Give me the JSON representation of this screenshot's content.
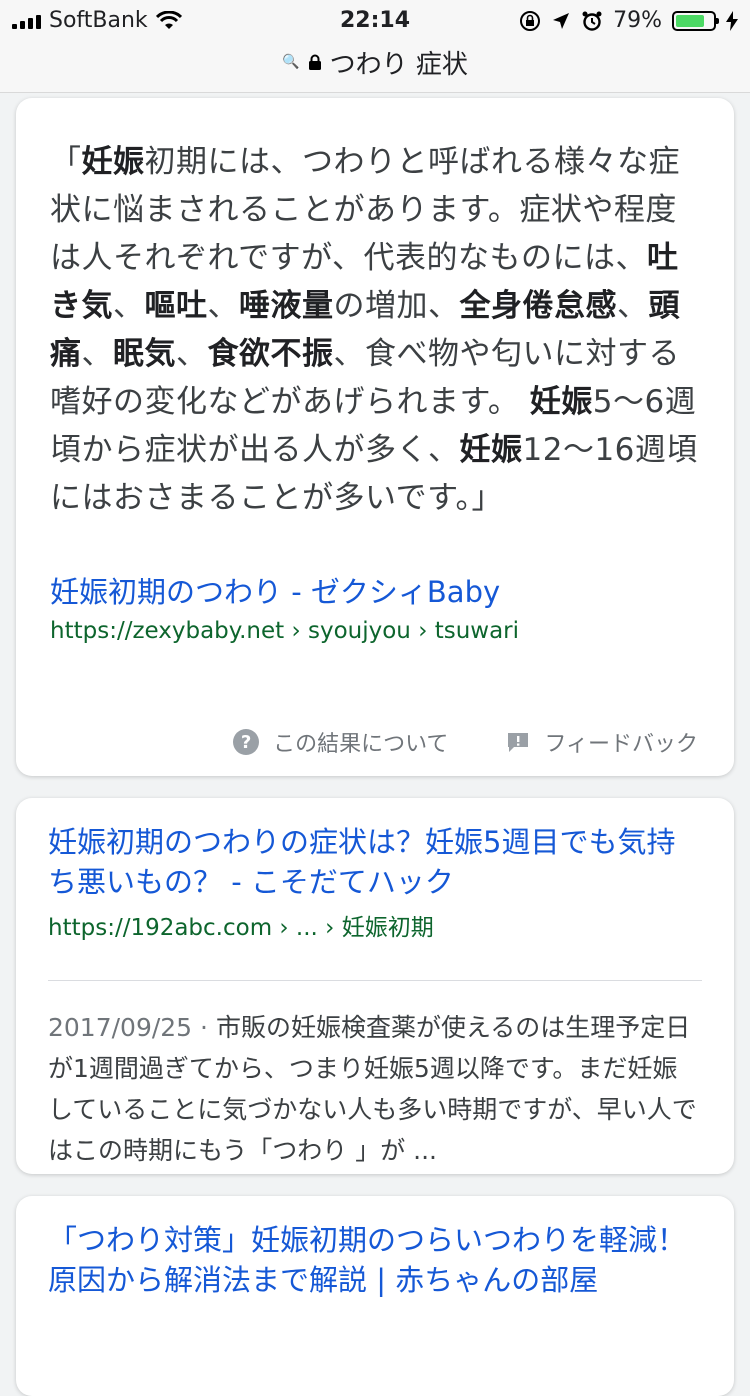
{
  "status_bar": {
    "carrier": "SoftBank",
    "time": "22:14",
    "battery_percent": "79%",
    "battery_level": 0.79
  },
  "address_bar": {
    "query": "つわり 症状"
  },
  "featured_snippet": {
    "q_open": "「",
    "q1_b": "妊娠",
    "q2": "初期には、つわりと呼ばれる様々な症状に悩まされることがあります。症状や程度は人それぞれですが、代表的なものには、",
    "q3_b": "吐き気",
    "q4": "、",
    "q5_b": "嘔吐",
    "q6": "、",
    "q7_b": "唾液量",
    "q8": "の増加、",
    "q9_b": "全身倦怠感",
    "q10": "、",
    "q11_b": "頭痛",
    "q12": "、",
    "q13_b": "眠気",
    "q14": "、",
    "q15_b": "食欲不振",
    "q16": "、食べ物や匂いに対する嗜好の変化などがあげられます。 ",
    "q17_b": "妊娠",
    "q18": "5〜6週頃から症状が出る人が多く、",
    "q19_b": "妊娠",
    "q20": "12〜16週頃にはおさまることが多いです。」",
    "title": "妊娠初期のつわり - ゼクシィBaby",
    "url": "https://zexybaby.net › syoujyou › tsuwari",
    "about_label": "この結果について",
    "feedback_label": "フィードバック"
  },
  "result2": {
    "title": "妊娠初期のつわりの症状は？妊娠5週目でも気持ち悪いもの？ - こそだてハック",
    "url": "https://192abc.com › ... › 妊娠初期",
    "date": "2017/09/25",
    "sep": " · ",
    "snippet": "市販の妊娠検査薬が使えるのは生理予定日が1週間過ぎてから、つまり妊娠5週以降です。まだ妊娠していることに気づかない人も多い時期ですが、早い人ではこの時期にもう「つわり 」が ..."
  },
  "result3": {
    "title": "「つわり対策」妊娠初期のつらいつわりを軽減！原因から解消法まで解説 | 赤ちゃんの部屋"
  }
}
